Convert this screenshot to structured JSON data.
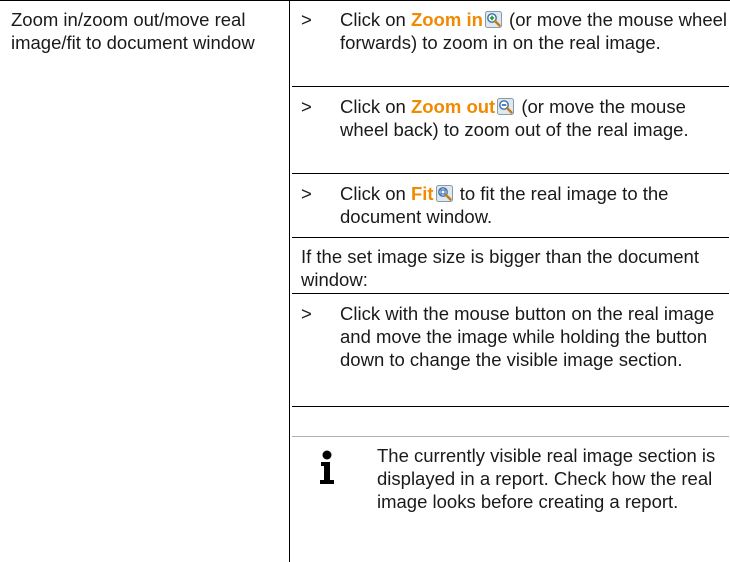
{
  "left_cell": {
    "text": "Zoom in/zoom out/move real image/fit to document window"
  },
  "steps": [
    {
      "marker": ">",
      "prefix": "Click on ",
      "keyword": "Zoom in",
      "icon": "zoom-in-icon",
      "suffix": " (or move the mouse wheel forwards) to zoom in on the real image."
    },
    {
      "marker": ">",
      "prefix": "Click on ",
      "keyword": "Zoom out",
      "icon": "zoom-out-icon",
      "suffix": " (or move the mouse wheel back) to zoom out of the real image."
    },
    {
      "marker": ">",
      "prefix": "Click on ",
      "keyword": "Fit",
      "icon": "fit-icon",
      "suffix": " to fit the real image to the document window."
    }
  ],
  "condition_text": "If the set image size is bigger than the document window:",
  "drag_step": {
    "marker": ">",
    "text": "Click with the mouse button on the real image and move the image while holding the button down to change the visible image section."
  },
  "note": {
    "icon": "info-icon",
    "text": "The currently visible real image section is displayed in a report. Check how the real image looks before creating a report."
  },
  "colors": {
    "keyword": "#f08a00",
    "text": "#1a1a1a",
    "border": "#000000"
  }
}
